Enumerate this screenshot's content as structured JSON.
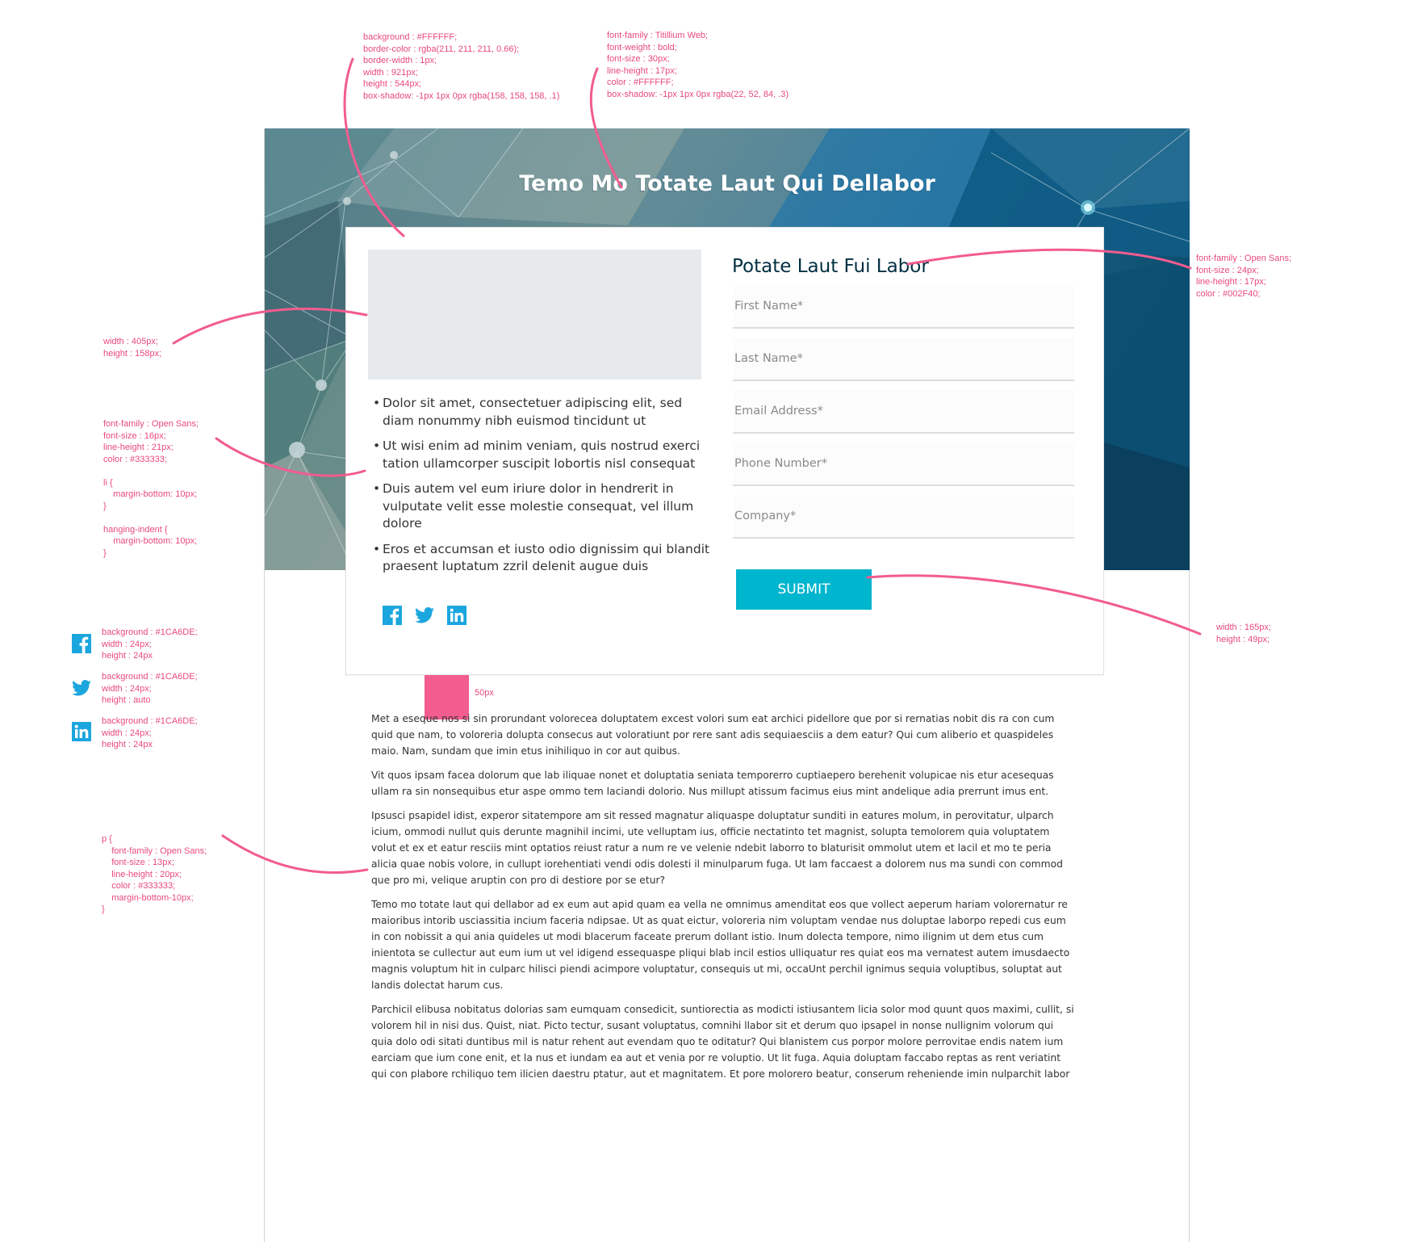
{
  "annotations": {
    "card_spec": "background : #FFFFFF;\nborder-color : rgba(211, 211, 211, 0.66);\nborder-width : 1px;\nwidth : 921px;\nheight : 544px;\nbox-shadow: -1px 1px 0px rgba(158, 158, 158, .1)",
    "title_spec": "font-family : Titillium Web;\nfont-weight : bold;\nfont-size : 30px;\nline-height : 17px;\ncolor : #FFFFFF;\nbox-shadow: -1px 1px 0px rgba(22, 52, 84, .3)",
    "form_title_spec": "font-family : Open Sans;\nfont-size : 24px;\nline-height : 17px;\ncolor : #002F40;",
    "image_spec": "width : 405px;\nheight : 158px;",
    "list_spec": "font-family : Open Sans;\nfont-size : 16px;\nline-height : 21px;\ncolor : #333333;\n\nli {\n    margin-bottom: 10px;\n}\n\nhanging-indent {\n    margin-bottom: 10px;\n}",
    "submit_spec": "width : 165px;\nheight : 49px;",
    "facebook_spec": "background : #1CA6DE;\nwidth : 24px;\nheight : 24px",
    "twitter_spec": "background : #1CA6DE;\nwidth : 24px;\nheight : auto",
    "linkedin_spec": "background : #1CA6DE;\nwidth : 24px;\nheight : 24px",
    "paragraph_spec": "p {\n    font-family : Open Sans;\n    font-size : 13px;\n    line-height : 20px;\n    color : #333333;\n    margin-bottom-10px;\n}",
    "gap_label": "50px"
  },
  "hero": {
    "title": "Temo Mo Totate Laut Qui Dellabor"
  },
  "card": {
    "bullets": [
      "Dolor sit amet, consectetuer adipiscing elit, sed diam nonummy nibh euismod tincidunt ut",
      "Ut wisi enim ad minim veniam, quis nostrud exerci tation ullamcorper suscipit lobortis nisl consequat",
      "Duis autem vel eum iriure dolor in hendrerit in vulputate velit esse molestie consequat, vel illum dolore",
      "Eros et accumsan et iusto odio dignissim qui blandit praesent luptatum zzril delenit augue duis"
    ],
    "social_icons": [
      "facebook-icon",
      "twitter-icon",
      "linkedin-icon"
    ]
  },
  "form": {
    "title": "Potate Laut Fui Labor",
    "fields": {
      "first_name": {
        "placeholder": "First Name*",
        "value": ""
      },
      "last_name": {
        "placeholder": "Last Name*",
        "value": ""
      },
      "email": {
        "placeholder": "Email Address*",
        "value": ""
      },
      "phone": {
        "placeholder": "Phone Number*",
        "value": ""
      },
      "company": {
        "placeholder": "Company*",
        "value": ""
      }
    },
    "submit_label": "SUBMIT"
  },
  "body": {
    "paragraphs": [
      "Met a eseque nos si sin prorundant volorecea doluptatem excest volori sum eat archici pidellore que por si rernatias nobit dis ra con cum quid que nam, to voloreria dolupta consecus aut voloratiunt por rere sant adis sequiaesciis a dem eatur? Qui cum aliberio et quaspideles maio. Nam, sundam que imin etus inihiliquo in cor aut quibus.",
      "Vit quos ipsam facea dolorum que lab iliquae nonet et doluptatia seniata temporerro cuptiaepero berehenit volupicae nis etur acesequas ullam ra sin nonsequibus etur aspe ommo tem laciandi dolorio. Nus millupt atissum facimus eius mint andelique adia prerrunt imus ent.",
      "Ipsusci psapidel idist, experor sitatempore am sit ressed magnatur aliquaspe doluptatur sunditi in eatures molum, in perovitatur, ulparch icium, ommodi nullut quis derunte magnihil incimi, ute velluptam ius, officie nectatinto tet magnist, solupta temolorem quia voluptatem volut et ex et eatur resciis mint optatios reiust ratur a num re ve velenie ndebit laborro to blaturisit ommolut utem et lacil et mo te peria alicia quae nobis volore, in cullupt iorehentiati vendi odis dolesti il minulparum fuga. Ut lam faccaest a dolorem nus ma sundi con commod que pro mi, velique aruptin con pro di destiore por se etur?",
      "Temo mo totate laut qui dellabor ad ex eum aut apid quam ea vella ne omnimus amenditat eos que vollect aeperum hariam volorernatur re maioribus intorib usciassitia incium faceria ndipsae. Ut as quat eictur, voloreria nim voluptam vendae nus doluptae laborpo repedi cus eum in con nobissit a qui ania quideles ut modi blacerum faceate prerum dollant istio. Inum dolecta tempore, nimo ilignim ut dem etus cum inientota se cullectur aut eum ium ut vel idigend essequaspe pliqui blab incil estios ulliquatur res quiat eos ma vernatest autem imusdaecto magnis voluptum hit in culparc hilisci piendi acimpore voluptatur, consequis ut mi, occaUnt perchil ignimus sequia voluptibus, soluptat aut landis dolectat harum cus.",
      "Parchicil elibusa nobitatus dolorias sam eumquam consedicit, suntiorectia as modicti istiusantem licia solor mod quunt quos maximi, cullit, si volorem hil in nisi dus. Quist, niat. Picto tectur, susant voluptatus, comnihi llabor sit et derum quo ipsapel in nonse nullignim volorum qui quia dolo odi sitati duntibus mil is natur rehent aut evendam quo te oditatur? Qui blanistem cus porpor molore perrovitae endis natem ium earciam que ium cone enit, et la nus et iundam ea aut et venia por re voluptio. Ut lit fuga. Aquia doluptam faccabo reptas as rent veriatint qui con plabore rchiliquo tem ilicien daestru ptatur, aut et magnitatem. Et pore molorero beatur, conserum reheniende imin nulparchit labor"
    ]
  },
  "colors": {
    "annotation": "#E8497C",
    "social": "#1CA6DE",
    "submit": "#00B5CE",
    "form_title": "#002F40",
    "text": "#333333"
  }
}
